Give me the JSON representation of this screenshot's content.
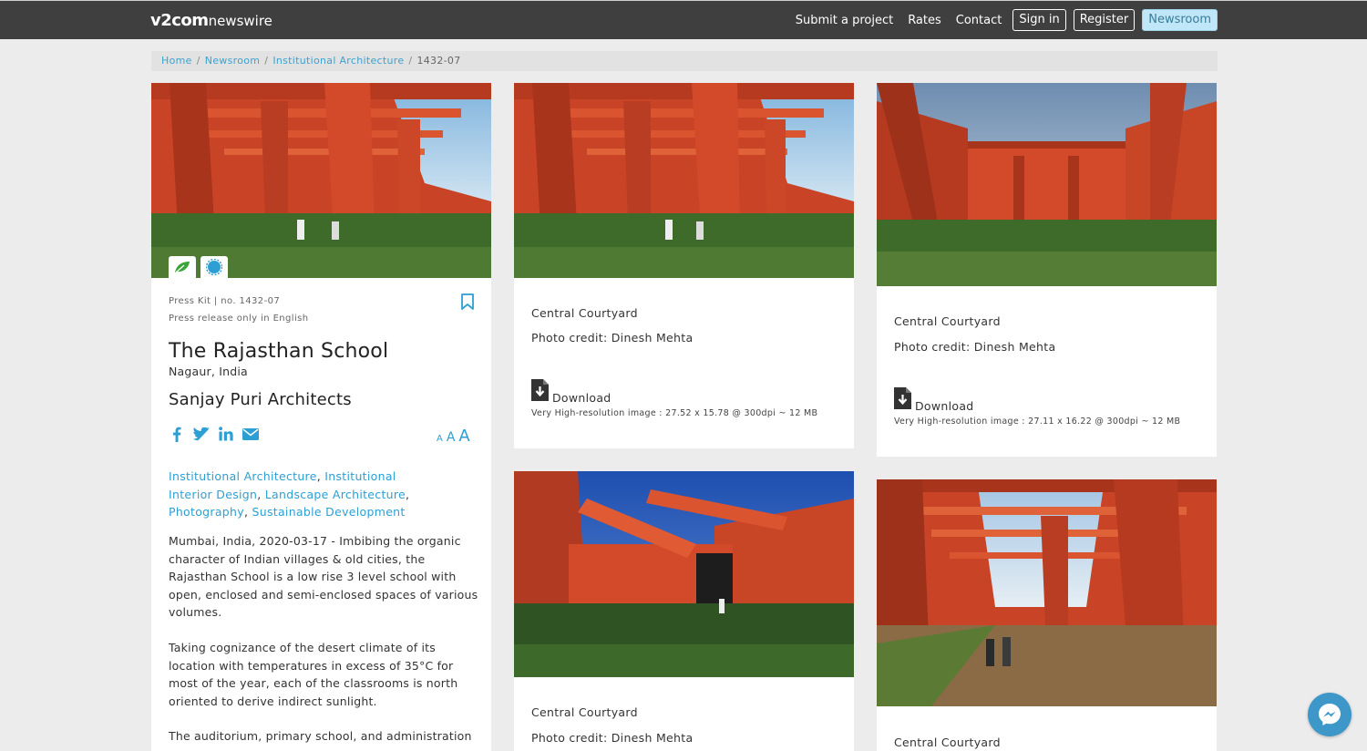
{
  "site": {
    "brand": "v2com",
    "subbrand": "newswire"
  },
  "nav": {
    "links": [
      "Submit a project",
      "Rates",
      "Contact"
    ],
    "sign_in": "Sign in",
    "register": "Register",
    "newsroom": "Newsroom"
  },
  "breadcrumb": {
    "home": "Home",
    "newsroom": "Newsroom",
    "category": "Institutional Architecture",
    "current": "1432-07"
  },
  "project": {
    "press_kit": "Press Kit | no. 1432-07",
    "language_note": "Press release only in English",
    "title": "The Rajasthan School",
    "location": "Nagaur, India",
    "firm": "Sanjay Puri Architects",
    "text_sizes": [
      "A",
      "A",
      "A"
    ],
    "tags": [
      "Institutional Architecture",
      "Institutional Interior Design",
      "Landscape Architecture",
      "Photography",
      "Sustainable Development"
    ],
    "tag_sep": ", ",
    "paragraphs": [
      "Mumbai, India, 2020-03-17 - Imbibing the organic character of Indian villages & old cities, the Rajasthan School is a low rise 3 level school with open, enclosed and semi-enclosed spaces of various volumes.",
      "Taking cognizance of the desert climate of its location with temperatures in excess of 35°C for most of the year, each of the classrooms is north oriented to derive indirect sunlight.",
      "The auditorium, primary school, and administration"
    ]
  },
  "gallery": [
    {
      "caption": "Central Courtyard",
      "credit": "Photo credit: Dinesh Mehta",
      "download": "Download",
      "spec": "Very High-resolution image : 27.52 x 15.78 @ 300dpi ~ 12 MB"
    },
    {
      "caption": "Central Courtyard",
      "credit": "Photo credit: Dinesh Mehta",
      "download": "Download",
      "spec": "Very High-resolution image : 27.11 x 16.22 @ 300dpi ~ 12 MB"
    },
    {
      "caption": "Central Courtyard",
      "credit": "Photo credit: Dinesh Mehta"
    },
    {
      "caption": "Central Courtyard"
    }
  ],
  "colors": {
    "navbar": "#3f3f3f",
    "accent_link": "#2d9fd3",
    "newsroom_button": "#bfe7f7",
    "architecture_red": "#d9482a",
    "grass": "#3f6b2a"
  },
  "icons": {
    "badge_1": "leaf-icon",
    "badge_2": "gear-badge-icon",
    "bookmark": "bookmark-icon",
    "share": [
      "facebook-icon",
      "twitter-icon",
      "linkedin-icon",
      "email-icon"
    ],
    "download": "download-file-icon",
    "chat": "messenger-icon"
  }
}
